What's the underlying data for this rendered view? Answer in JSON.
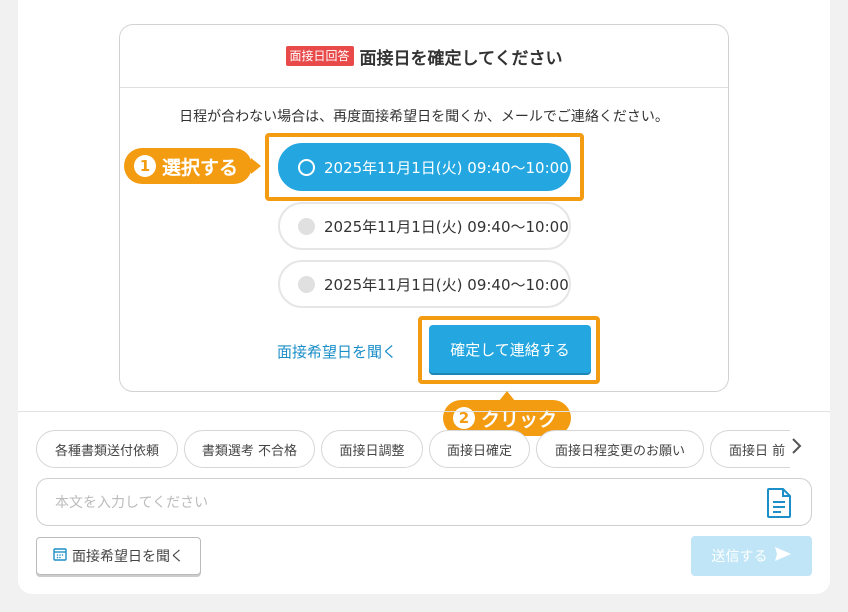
{
  "card": {
    "tag": "面接日回答",
    "title": "面接日を確定してください",
    "note": "日程が合わない場合は、再度面接希望日を聞くか、メールでご連絡ください。",
    "options": [
      {
        "label": "2025年11月1日(火) 09:40〜10:00",
        "selected": true
      },
      {
        "label": "2025年11月1日(火) 09:40〜10:00",
        "selected": false
      },
      {
        "label": "2025年11月1日(火) 09:40〜10:00",
        "selected": false
      }
    ],
    "ask_link": "面接希望日を聞く",
    "confirm_button": "確定して連絡する"
  },
  "callouts": {
    "step1_num": "1",
    "step1_label": "選択する",
    "step2_num": "2",
    "step2_label": "クリック"
  },
  "templates": [
    "各種書類送付依頼",
    "書類選考 不合格",
    "面接日調整",
    "面接日確定",
    "面接日程変更のお願い"
  ],
  "template_partial": "面接日 前",
  "composer": {
    "placeholder": "本文を入力してください",
    "ask_button": "面接希望日を聞く",
    "send_button": "送信する"
  },
  "colors": {
    "accent": "#24a7e0",
    "highlight": "#f39c12",
    "tag": "#e84a4a",
    "send_disabled": "#bfe5f6"
  }
}
